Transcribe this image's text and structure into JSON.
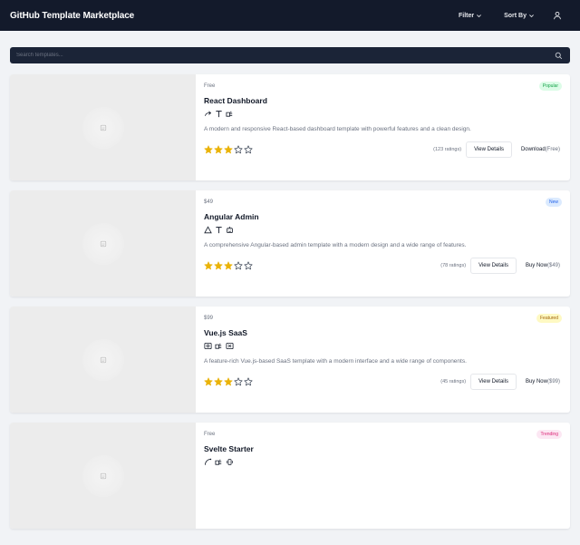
{
  "app": {
    "title": "GitHub Template Marketplace"
  },
  "header": {
    "filter_label": "Filter",
    "sort_label": "Sort By"
  },
  "search": {
    "placeholder": "Search templates..."
  },
  "colors": {
    "popular_badge_bg": "#dcfce7",
    "popular_badge_fg": "#16a34a",
    "new_badge_bg": "#dbeafe",
    "new_badge_fg": "#2563eb",
    "featured_badge_bg": "#fef9c3",
    "featured_badge_fg": "#a16207",
    "trending_badge_bg": "#fce7f3",
    "trending_badge_fg": "#db2777",
    "star": "#eab308"
  },
  "templates": [
    {
      "price_tag": "Free",
      "badge": "Popular",
      "title": "React Dashboard",
      "tech_icons": [
        "share-icon",
        "type-icon",
        "plugin-icon"
      ],
      "description": "A modern and responsive React-based dashboard template with powerful features and a clean design.",
      "rating": 3,
      "rating_max": 5,
      "ratings_text": "(123 ratings)",
      "details_label": "View Details",
      "buy_label": "Download",
      "buy_price": "(Free)"
    },
    {
      "price_tag": "$49",
      "badge": "New",
      "title": "Angular Admin",
      "tech_icons": [
        "triangle-icon",
        "type-icon",
        "robot-icon"
      ],
      "description": "A comprehensive Angular-based admin template with a modern design and a wide range of features.",
      "rating": 3,
      "rating_max": 5,
      "ratings_text": "(78 ratings)",
      "details_label": "View Details",
      "buy_label": "Buy Now",
      "buy_price": "($49)"
    },
    {
      "price_tag": "$99",
      "badge": "Featured",
      "title": "Vue.js SaaS",
      "tech_icons": [
        "settings-box-icon",
        "plugin-icon",
        "x-box-icon"
      ],
      "description": "A feature-rich Vue.js-based SaaS template with a modern interface and a wide range of components.",
      "rating": 3,
      "rating_max": 5,
      "ratings_text": "(45 ratings)",
      "details_label": "View Details",
      "buy_label": "Buy Now",
      "buy_price": "($99)"
    },
    {
      "price_tag": "Free",
      "badge": "Trending",
      "title": "Svelte Starter",
      "tech_icons": [
        "curve-icon",
        "plugin-icon",
        "vibrate-icon"
      ]
    }
  ]
}
